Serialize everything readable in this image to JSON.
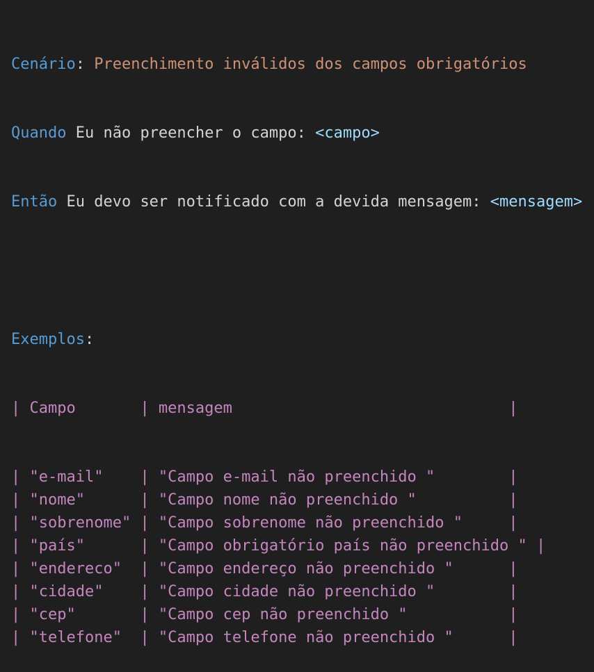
{
  "scenario": {
    "keyword": "Cenário",
    "colon": ":",
    "title": " Preenchimento inválidos dos campos obrigatórios"
  },
  "when": {
    "keyword": "Quando",
    "text": " Eu não preencher o campo: ",
    "placeholder": "<campo>"
  },
  "then": {
    "keyword": "Então",
    "text": " Eu devo ser notificado com a devida mensagem: ",
    "placeholder": "<mensagem>"
  },
  "examples": {
    "keyword": "Exemplos",
    "colon": ":",
    "pipe": "|",
    "header": {
      "col1": " Campo       ",
      "col2": " mensagem                              "
    },
    "rows": [
      {
        "col1": " \"e-mail\"    ",
        "col2": " \"Campo e-mail não preenchido \"        "
      },
      {
        "col1": " \"nome\"      ",
        "col2": " \"Campo nome não preenchido \"          "
      },
      {
        "col1": " \"sobrenome\" ",
        "col2": " \"Campo sobrenome não preenchido \"     "
      },
      {
        "col1": " \"país\"      ",
        "col2": " \"Campo obrigatório país não preenchido \" "
      },
      {
        "col1": " \"endereco\"  ",
        "col2": " \"Campo endereço não preenchido \"      "
      },
      {
        "col1": " \"cidade\"    ",
        "col2": " \"Campo cidade não preenchido \"        "
      },
      {
        "col1": " \"cep\"       ",
        "col2": " \"Campo cep não preenchido \"           "
      },
      {
        "col1": " \"telefone\"  ",
        "col2": " \"Campo telefone não preenchido \"      "
      }
    ]
  }
}
